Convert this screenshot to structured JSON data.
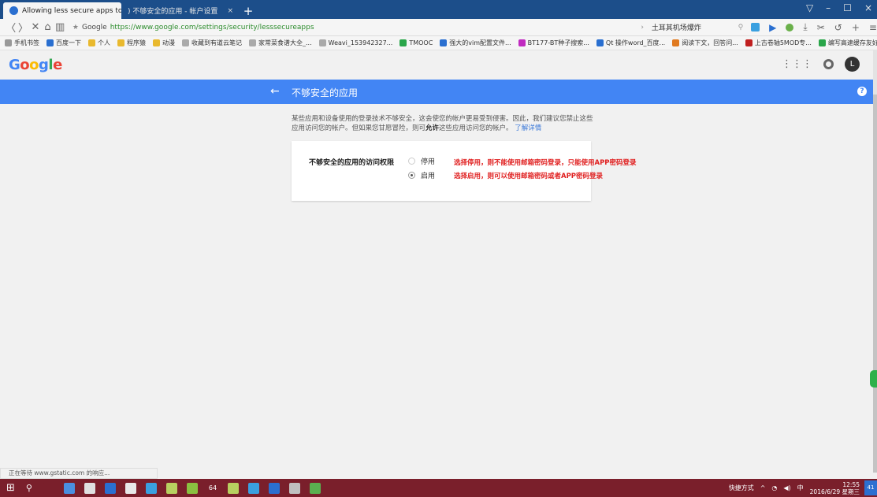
{
  "browser": {
    "tabs": [
      {
        "label": "Allowing less secure apps to acce",
        "active": true
      },
      {
        "label": ") 不够安全的应用 - 帐户设置",
        "active": false
      }
    ],
    "new_tab": "+",
    "window_controls": [
      "▽",
      "–",
      "☐",
      "×"
    ],
    "nav_buttons": [
      "〈",
      "〉",
      "✕",
      "⌂",
      "▥"
    ],
    "url_star": "★",
    "url_host": "Google",
    "url": "https://www.google.com/settings/security/lesssecureapps",
    "search_arrow": "›",
    "search_text": "土耳其机场爆炸",
    "right_tools": [
      "⤓",
      "✂",
      "↺",
      "+",
      "≡"
    ]
  },
  "bookmarks": [
    {
      "label": "手机书签",
      "color": "#999999"
    },
    {
      "label": "百度一下",
      "color": "#2a6fd0"
    },
    {
      "label": "个人",
      "color": "#e9b92e"
    },
    {
      "label": "程序猿",
      "color": "#e9b92e"
    },
    {
      "label": "动漫",
      "color": "#e9b92e"
    },
    {
      "label": "收藏到有道云笔记",
      "color": "#aaaaaa"
    },
    {
      "label": "家常菜食谱大全_...",
      "color": "#aaaaaa"
    },
    {
      "label": "Weavi_153942327...",
      "color": "#aaaaaa"
    },
    {
      "label": "TMOOC",
      "color": "#2aa64a"
    },
    {
      "label": "强大的vim配置文件...",
      "color": "#2a6fd0"
    },
    {
      "label": "BT177-BT种子搜索...",
      "color": "#c02ac0"
    },
    {
      "label": "Qt 操作word_百度...",
      "color": "#2a6fd0"
    },
    {
      "label": "阅读下文，回答问...",
      "color": "#e07a20"
    },
    {
      "label": "上古卷轴5MOD专...",
      "color": "#c02020"
    },
    {
      "label": "编写高速缓存友好...",
      "color": "#2aa64a"
    }
  ],
  "google": {
    "logo_letters": [
      {
        "ch": "G",
        "color": "#4285f4"
      },
      {
        "ch": "o",
        "color": "#ea4335"
      },
      {
        "ch": "o",
        "color": "#fbbc05"
      },
      {
        "ch": "g",
        "color": "#4285f4"
      },
      {
        "ch": "l",
        "color": "#34a853"
      },
      {
        "ch": "e",
        "color": "#ea4335"
      }
    ],
    "apps_icon": "⋮⋮⋮",
    "avatar_letter": "L"
  },
  "page": {
    "back_glyph": "←",
    "title": "不够安全的应用",
    "help_glyph": "?",
    "description_part1": "某些应用和设备使用的登录技术不够安全，这会使您的帐户更易受到侵害。因此，我们建议您禁止这些应用访问您的帐户。但如果您甘愿冒险，则可",
    "description_bold": "允许",
    "description_part2": "这些应用访问您的帐户。",
    "learn_more": "了解详情",
    "setting_label": "不够安全的应用的访问权限",
    "option_off": "停用",
    "option_on": "启用",
    "selected": "启用",
    "note_off": "选择停用，则不能使用邮箱密码登录，只能使用APP密码登录",
    "note_on": "选择启用，则可以使用邮箱密码或者APP密码登录"
  },
  "status_bar": "正在等待 www.gstatic.com 的响应...",
  "taskbar": {
    "start_glyph": "⊞",
    "search_glyph": "⚲",
    "apps": [
      "#7a1f2b",
      "#4a8fe0",
      "#e0e0e0",
      "#2a6fd0",
      "#e8e8e8",
      "#3aa0e0",
      "#b8d060",
      "#8ac040",
      "#e05050",
      "#b8d060",
      "#3aa0e0",
      "#2a6fd0",
      "#c0c0c0",
      "#5ab050"
    ],
    "app_64": "64",
    "tray_label": "快捷方式",
    "time": "12:55",
    "date": "2016/6/29 星期三",
    "notif": "41"
  }
}
